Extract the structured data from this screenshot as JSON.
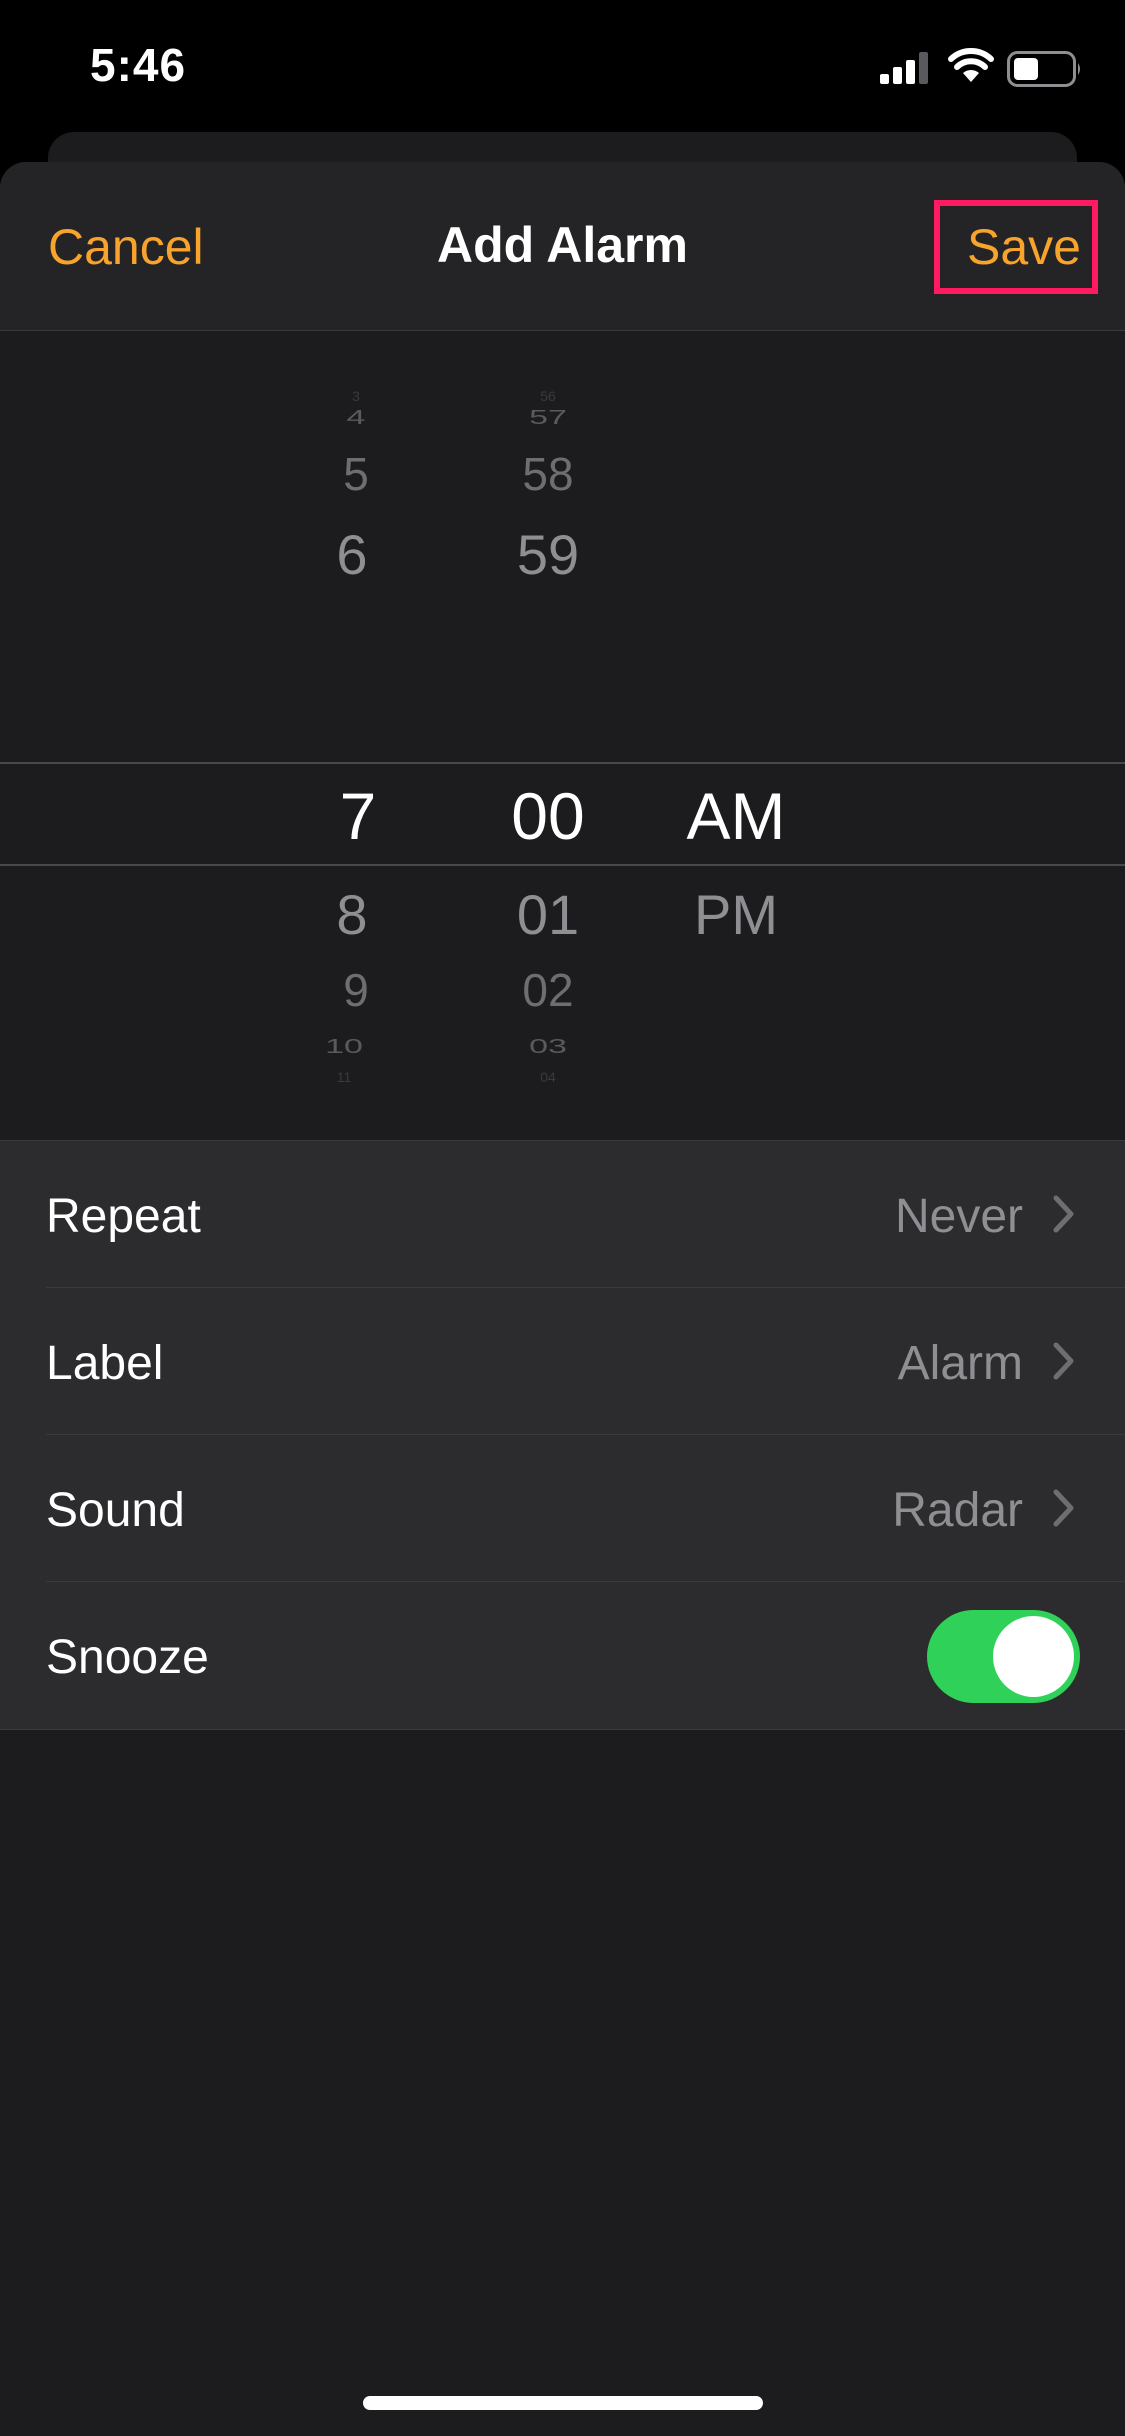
{
  "status_bar": {
    "time": "5:46"
  },
  "nav": {
    "cancel_label": "Cancel",
    "title": "Add Alarm",
    "save_label": "Save"
  },
  "picker": {
    "hours": [
      "3",
      "4",
      "5",
      "6",
      "7",
      "8",
      "9",
      "10",
      "11"
    ],
    "minutes": [
      "56",
      "57",
      "58",
      "59",
      "00",
      "01",
      "02",
      "03",
      "04"
    ],
    "periods": [
      "AM",
      "PM"
    ],
    "selected": {
      "hour": "7",
      "minute": "00",
      "period": "AM"
    }
  },
  "settings": {
    "rows": [
      {
        "label": "Repeat",
        "value": "Never"
      },
      {
        "label": "Label",
        "value": "Alarm"
      },
      {
        "label": "Sound",
        "value": "Radar"
      },
      {
        "label": "Snooze",
        "toggle": true
      }
    ]
  },
  "colors": {
    "accent": "#f7a32c",
    "toggle_on": "#30d158",
    "highlight_box": "#ff1a62"
  },
  "icons": {
    "signal": "cellular-signal-icon",
    "wifi": "wifi-icon",
    "battery": "battery-icon",
    "chevron": "chevron-right-icon"
  }
}
